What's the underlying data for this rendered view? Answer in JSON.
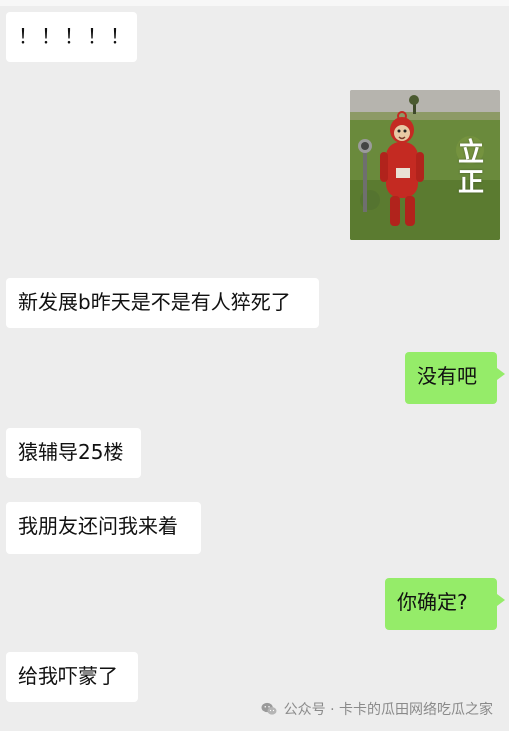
{
  "messages": [
    {
      "side": "left",
      "text": "！！！！！"
    },
    {
      "side": "right",
      "type": "sticker",
      "sticker_text": [
        "立",
        "正"
      ]
    },
    {
      "side": "left",
      "text": "新发展b昨天是不是有人猝死了"
    },
    {
      "side": "right",
      "text": "没有吧"
    },
    {
      "side": "left",
      "text": "猿辅导25楼"
    },
    {
      "side": "left",
      "text": "我朋友还问我来着"
    },
    {
      "side": "right",
      "text": "你确定?"
    },
    {
      "side": "left",
      "text": "给我吓蒙了"
    }
  ],
  "watermark": {
    "text": "公众号 · 卡卡的瓜田网络吃瓜之家",
    "icon": "wechat-icon"
  },
  "colors": {
    "background": "#ededed",
    "left_bubble": "#ffffff",
    "right_bubble": "#95ec69"
  }
}
